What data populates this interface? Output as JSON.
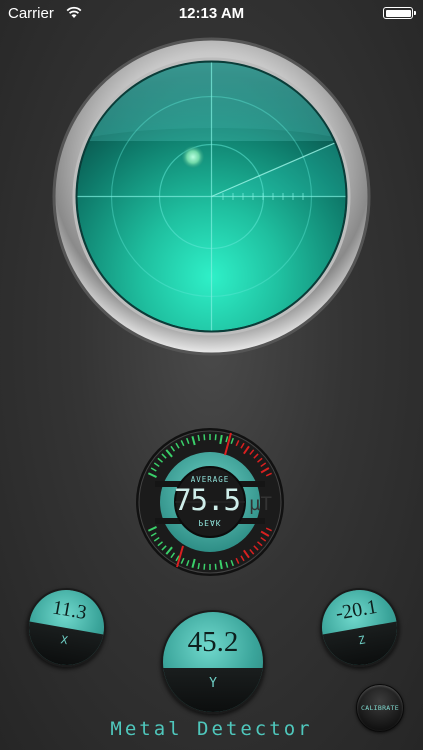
{
  "status_bar": {
    "carrier": "Carrier",
    "time": "12:13 AM",
    "wifi_icon": "wifi-icon",
    "battery_icon": "battery-icon"
  },
  "gauge": {
    "average_label": "AVERAGE",
    "value": "75.5",
    "unit": "µT",
    "peak_label": "PEAK"
  },
  "axes": {
    "x": {
      "value": "11.3",
      "label": "X"
    },
    "y": {
      "value": "45.2",
      "label": "Y"
    },
    "z": {
      "value": "-20.1",
      "label": "Z"
    }
  },
  "calibrate_label": "CALIBRATE",
  "app_title": "Metal Detector",
  "colors": {
    "accent": "#4fc7bc",
    "radar": "#1fbf9f",
    "dial_face": "#5cc8bc",
    "needle_red": "#d92020",
    "tick_green": "#3ad06a"
  }
}
